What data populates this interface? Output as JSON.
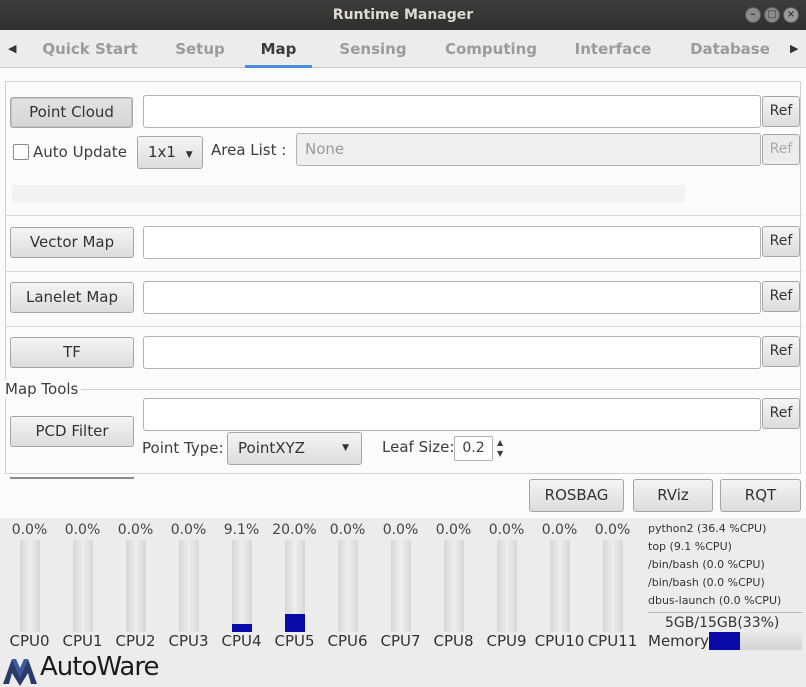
{
  "window": {
    "title": "Runtime Manager"
  },
  "tabs": [
    "Quick Start",
    "Setup",
    "Map",
    "Sensing",
    "Computing",
    "Interface",
    "Database"
  ],
  "active_tab": "Map",
  "point_cloud": {
    "button": "Point Cloud",
    "ref": "Ref",
    "auto_update": "Auto Update",
    "grid": "1x1",
    "area_list_label": "Area List :",
    "area_list_value": "None",
    "area_ref": "Ref"
  },
  "vector_map": {
    "button": "Vector Map",
    "ref": "Ref"
  },
  "lanelet_map": {
    "button": "Lanelet Map",
    "ref": "Ref"
  },
  "tf": {
    "button": "TF",
    "ref": "Ref"
  },
  "map_tools": {
    "label": "Map Tools",
    "pcd_filter": "PCD Filter",
    "ref": "Ref",
    "point_type_label": "Point Type:",
    "point_type_value": "PointXYZ",
    "leaf_size_label": "Leaf Size:",
    "leaf_size_value": "0.2"
  },
  "bottom_buttons": {
    "rosbag": "ROSBAG",
    "rviz": "RViz",
    "rqt": "RQT"
  },
  "cpus": [
    {
      "label": "CPU0",
      "pct": "0.0%",
      "value": 0.0
    },
    {
      "label": "CPU1",
      "pct": "0.0%",
      "value": 0.0
    },
    {
      "label": "CPU2",
      "pct": "0.0%",
      "value": 0.0
    },
    {
      "label": "CPU3",
      "pct": "0.0%",
      "value": 0.0
    },
    {
      "label": "CPU4",
      "pct": "9.1%",
      "value": 9.1
    },
    {
      "label": "CPU5",
      "pct": "20.0%",
      "value": 20.0
    },
    {
      "label": "CPU6",
      "pct": "0.0%",
      "value": 0.0
    },
    {
      "label": "CPU7",
      "pct": "0.0%",
      "value": 0.0
    },
    {
      "label": "CPU8",
      "pct": "0.0%",
      "value": 0.0
    },
    {
      "label": "CPU9",
      "pct": "0.0%",
      "value": 0.0
    },
    {
      "label": "CPU10",
      "pct": "0.0%",
      "value": 0.0
    },
    {
      "label": "CPU11",
      "pct": "0.0%",
      "value": 0.0
    }
  ],
  "processes": [
    "python2 (36.4 %CPU)",
    "top (9.1 %CPU)",
    "/bin/bash (0.0 %CPU)",
    "/bin/bash (0.0 %CPU)",
    "dbus-launch (0.0 %CPU)"
  ],
  "memory": {
    "text": "5GB/15GB(33%)",
    "label": "Memory",
    "value": 33
  },
  "logo": {
    "text": "AutoWare"
  },
  "colors": {
    "accent": "#4a90d9",
    "bar_fill": "#0a0aa8",
    "titlebar": "#363634"
  }
}
